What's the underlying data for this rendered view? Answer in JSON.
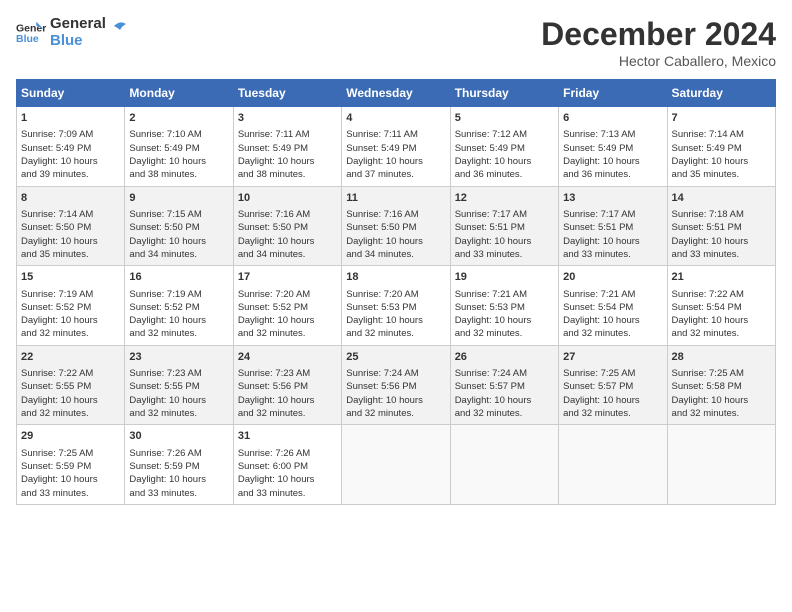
{
  "header": {
    "logo_line1": "General",
    "logo_line2": "Blue",
    "title": "December 2024",
    "subtitle": "Hector Caballero, Mexico"
  },
  "weekdays": [
    "Sunday",
    "Monday",
    "Tuesday",
    "Wednesday",
    "Thursday",
    "Friday",
    "Saturday"
  ],
  "weeks": [
    [
      {
        "day": "1",
        "sunrise": "7:09 AM",
        "sunset": "5:49 PM",
        "daylight": "10 hours and 39 minutes."
      },
      {
        "day": "2",
        "sunrise": "7:10 AM",
        "sunset": "5:49 PM",
        "daylight": "10 hours and 38 minutes."
      },
      {
        "day": "3",
        "sunrise": "7:11 AM",
        "sunset": "5:49 PM",
        "daylight": "10 hours and 38 minutes."
      },
      {
        "day": "4",
        "sunrise": "7:11 AM",
        "sunset": "5:49 PM",
        "daylight": "10 hours and 37 minutes."
      },
      {
        "day": "5",
        "sunrise": "7:12 AM",
        "sunset": "5:49 PM",
        "daylight": "10 hours and 36 minutes."
      },
      {
        "day": "6",
        "sunrise": "7:13 AM",
        "sunset": "5:49 PM",
        "daylight": "10 hours and 36 minutes."
      },
      {
        "day": "7",
        "sunrise": "7:14 AM",
        "sunset": "5:49 PM",
        "daylight": "10 hours and 35 minutes."
      }
    ],
    [
      {
        "day": "8",
        "sunrise": "7:14 AM",
        "sunset": "5:50 PM",
        "daylight": "10 hours and 35 minutes."
      },
      {
        "day": "9",
        "sunrise": "7:15 AM",
        "sunset": "5:50 PM",
        "daylight": "10 hours and 34 minutes."
      },
      {
        "day": "10",
        "sunrise": "7:16 AM",
        "sunset": "5:50 PM",
        "daylight": "10 hours and 34 minutes."
      },
      {
        "day": "11",
        "sunrise": "7:16 AM",
        "sunset": "5:50 PM",
        "daylight": "10 hours and 34 minutes."
      },
      {
        "day": "12",
        "sunrise": "7:17 AM",
        "sunset": "5:51 PM",
        "daylight": "10 hours and 33 minutes."
      },
      {
        "day": "13",
        "sunrise": "7:17 AM",
        "sunset": "5:51 PM",
        "daylight": "10 hours and 33 minutes."
      },
      {
        "day": "14",
        "sunrise": "7:18 AM",
        "sunset": "5:51 PM",
        "daylight": "10 hours and 33 minutes."
      }
    ],
    [
      {
        "day": "15",
        "sunrise": "7:19 AM",
        "sunset": "5:52 PM",
        "daylight": "10 hours and 32 minutes."
      },
      {
        "day": "16",
        "sunrise": "7:19 AM",
        "sunset": "5:52 PM",
        "daylight": "10 hours and 32 minutes."
      },
      {
        "day": "17",
        "sunrise": "7:20 AM",
        "sunset": "5:52 PM",
        "daylight": "10 hours and 32 minutes."
      },
      {
        "day": "18",
        "sunrise": "7:20 AM",
        "sunset": "5:53 PM",
        "daylight": "10 hours and 32 minutes."
      },
      {
        "day": "19",
        "sunrise": "7:21 AM",
        "sunset": "5:53 PM",
        "daylight": "10 hours and 32 minutes."
      },
      {
        "day": "20",
        "sunrise": "7:21 AM",
        "sunset": "5:54 PM",
        "daylight": "10 hours and 32 minutes."
      },
      {
        "day": "21",
        "sunrise": "7:22 AM",
        "sunset": "5:54 PM",
        "daylight": "10 hours and 32 minutes."
      }
    ],
    [
      {
        "day": "22",
        "sunrise": "7:22 AM",
        "sunset": "5:55 PM",
        "daylight": "10 hours and 32 minutes."
      },
      {
        "day": "23",
        "sunrise": "7:23 AM",
        "sunset": "5:55 PM",
        "daylight": "10 hours and 32 minutes."
      },
      {
        "day": "24",
        "sunrise": "7:23 AM",
        "sunset": "5:56 PM",
        "daylight": "10 hours and 32 minutes."
      },
      {
        "day": "25",
        "sunrise": "7:24 AM",
        "sunset": "5:56 PM",
        "daylight": "10 hours and 32 minutes."
      },
      {
        "day": "26",
        "sunrise": "7:24 AM",
        "sunset": "5:57 PM",
        "daylight": "10 hours and 32 minutes."
      },
      {
        "day": "27",
        "sunrise": "7:25 AM",
        "sunset": "5:57 PM",
        "daylight": "10 hours and 32 minutes."
      },
      {
        "day": "28",
        "sunrise": "7:25 AM",
        "sunset": "5:58 PM",
        "daylight": "10 hours and 32 minutes."
      }
    ],
    [
      {
        "day": "29",
        "sunrise": "7:25 AM",
        "sunset": "5:59 PM",
        "daylight": "10 hours and 33 minutes."
      },
      {
        "day": "30",
        "sunrise": "7:26 AM",
        "sunset": "5:59 PM",
        "daylight": "10 hours and 33 minutes."
      },
      {
        "day": "31",
        "sunrise": "7:26 AM",
        "sunset": "6:00 PM",
        "daylight": "10 hours and 33 minutes."
      },
      null,
      null,
      null,
      null
    ]
  ]
}
